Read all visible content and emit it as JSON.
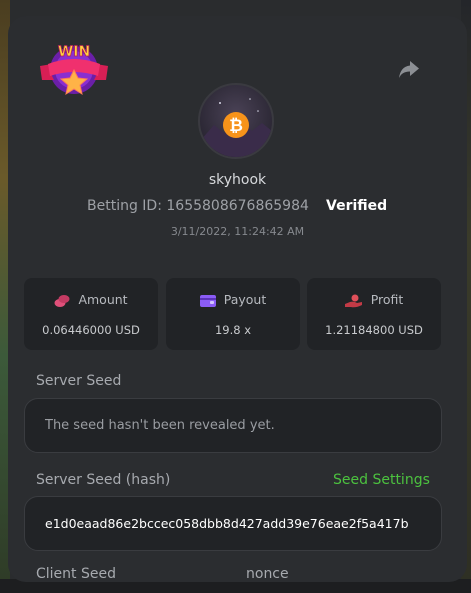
{
  "header": {
    "badge_text": "WIN",
    "username": "skyhook",
    "betting_id_label": "Betting ID:",
    "betting_id_value": "1655808676865984",
    "verified_label": "Verified",
    "timestamp": "3/11/2022, 11:24:42 AM"
  },
  "stats": [
    {
      "label": "Amount",
      "value": "0.06446000 USD",
      "icon": "coins-icon",
      "color": "#e0507a"
    },
    {
      "label": "Payout",
      "value": "19.8 x",
      "icon": "wallet-icon",
      "color": "#8b5cf6"
    },
    {
      "label": "Profit",
      "value": "1.21184800 USD",
      "icon": "hand-coin-icon",
      "color": "#e0505a"
    }
  ],
  "server_seed": {
    "label": "Server Seed",
    "value": "The seed hasn't been revealed yet."
  },
  "server_seed_hash": {
    "label": "Server Seed (hash)",
    "settings_link": "Seed Settings",
    "value": "e1d0eaad86e2bccec058dbb8d427add39e76eae2f5a417b"
  },
  "client_seed": {
    "label": "Client Seed",
    "nonce_label": "nonce"
  },
  "colors": {
    "accent_green": "#4cc23f",
    "panel_bg": "#2b2d30",
    "card_bg": "#212326",
    "bitcoin_orange": "#f7931a"
  }
}
